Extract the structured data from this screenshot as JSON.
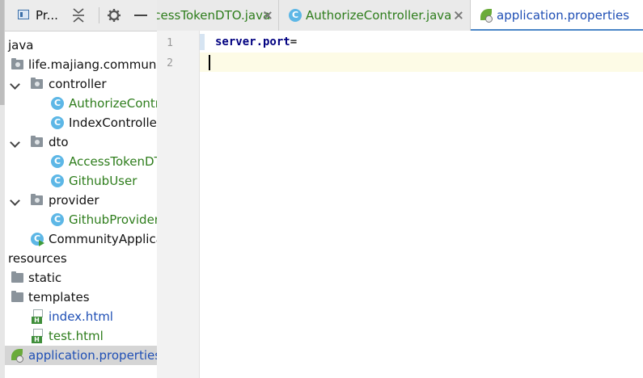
{
  "project_panel": {
    "title": "Pr...",
    "tree": [
      {
        "label": "java"
      },
      {
        "label": "life.majiang.community"
      },
      {
        "label": "controller"
      },
      {
        "label": "AuthorizeController"
      },
      {
        "label": "IndexController"
      },
      {
        "label": "dto"
      },
      {
        "label": "AccessTokenDTO"
      },
      {
        "label": "GithubUser"
      },
      {
        "label": "provider"
      },
      {
        "label": "GithubProvider"
      },
      {
        "label": "CommunityApplication"
      },
      {
        "label": "resources"
      },
      {
        "label": "static"
      },
      {
        "label": "templates"
      },
      {
        "label": "index.html"
      },
      {
        "label": "test.html"
      },
      {
        "label": "application.properties"
      }
    ]
  },
  "tabs": [
    {
      "label": "AccessTokenDTO.java"
    },
    {
      "label": "AuthorizeController.java"
    },
    {
      "label": "application.properties"
    }
  ],
  "editor": {
    "lines": [
      "1",
      "2"
    ],
    "code_key": "server.port",
    "code_eq": "="
  },
  "colors": {
    "class_icon": "#5db7e6",
    "green_text": "#2e7d1c",
    "blue_text": "#1f4fb5",
    "active_tab_underline": "#4a86c7"
  }
}
